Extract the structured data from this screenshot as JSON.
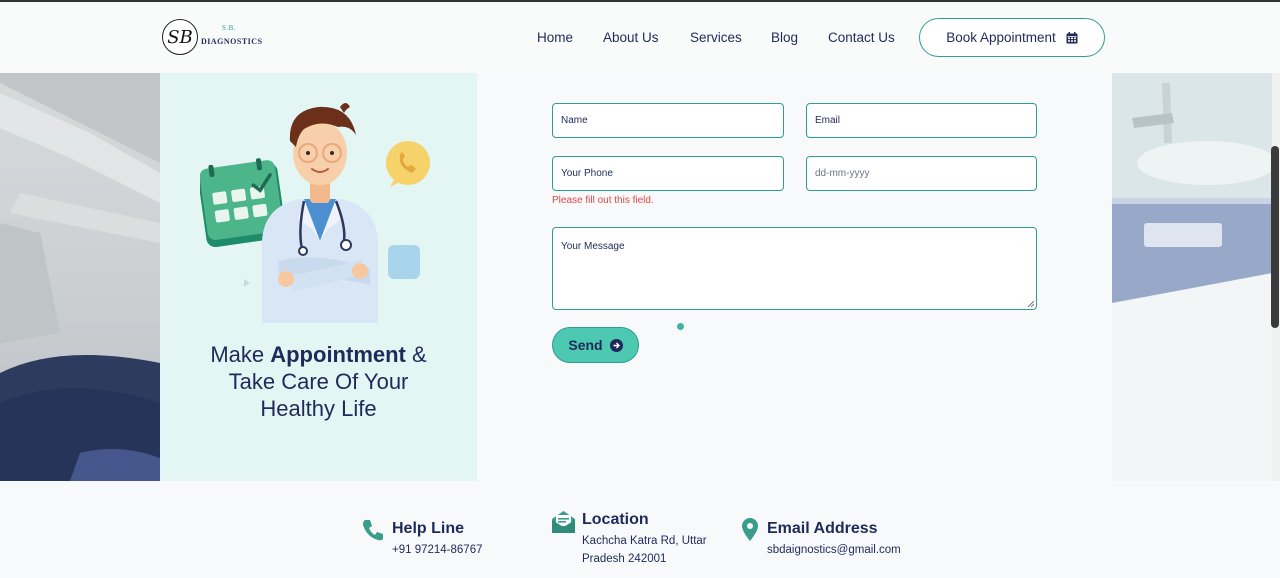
{
  "brand": {
    "small": "S.B.",
    "name": "DIAGNOSTICS",
    "monogram": "SB"
  },
  "nav": {
    "items": [
      "Home",
      "About Us",
      "Services",
      "Blog",
      "Contact Us"
    ],
    "book_label": "Book Appointment"
  },
  "hero": {
    "line1_a": "Make ",
    "line1_b": "Appointment",
    "line1_c": " &",
    "line2": "Take Care Of Your",
    "line3": "Healthy Life"
  },
  "form": {
    "name_placeholder": "Name",
    "email_placeholder": "Email",
    "phone_placeholder": "Your Phone",
    "date_placeholder": "dd-mm-yyyy",
    "validation_error": "Please fill out this field.",
    "message_placeholder": "Your Message",
    "send_label": "Send"
  },
  "contact": {
    "helpline_title": "Help Line",
    "helpline_value": "+91 97214-86767",
    "location_title": "Location",
    "location_line1": "Kachcha Katra Rd, Uttar",
    "location_line2": "Pradesh 242001",
    "email_title": "Email Address",
    "email_value": "sbdaignostics@gmail.com"
  },
  "colors": {
    "accent": "#2f9e8f",
    "button_fill": "#4cc9b0",
    "navy": "#1f2a5a",
    "panel_bg": "#e4f6f3",
    "error": "#e04848"
  },
  "icons": [
    "calendar-icon",
    "arrow-right-circle-icon",
    "phone-icon",
    "mail-open-icon",
    "map-pin-icon"
  ]
}
